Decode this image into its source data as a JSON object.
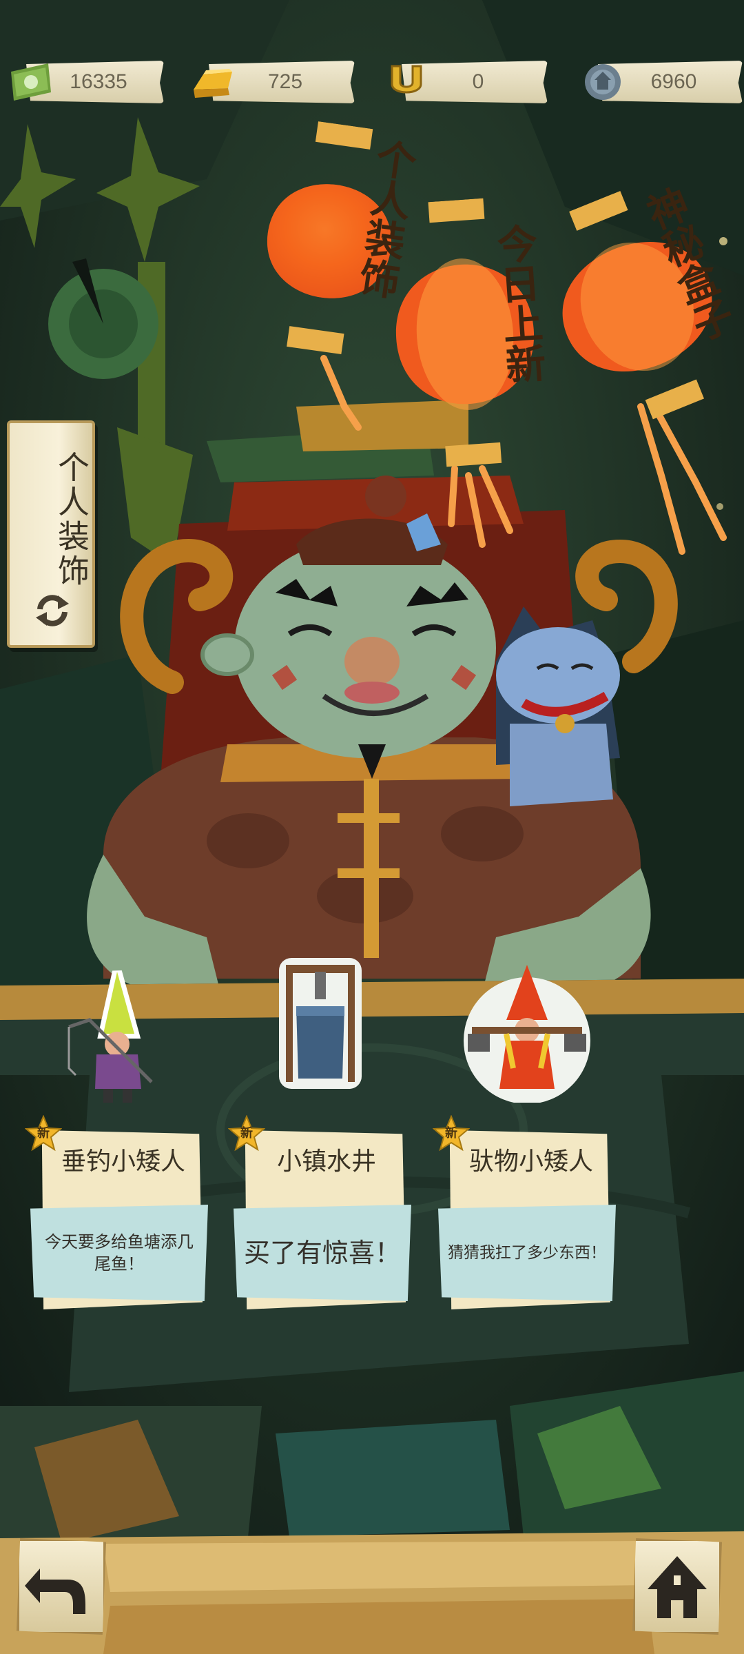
{
  "currency": [
    {
      "icon": "cash-icon",
      "value": "16335"
    },
    {
      "icon": "gold-bar-icon",
      "value": "725"
    },
    {
      "icon": "horseshoe-icon",
      "value": "0"
    },
    {
      "icon": "gear-token-icon",
      "value": "6960"
    }
  ],
  "lanterns": [
    {
      "label": "个人装饰"
    },
    {
      "label": "今日上新"
    },
    {
      "label": "神秘盒子"
    }
  ],
  "side_tab": {
    "label": "个人装饰",
    "icon": "refresh-icon"
  },
  "items": [
    {
      "badge": "新",
      "name": "垂钓小矮人",
      "desc": "今天要多给鱼塘添几尾鱼！"
    },
    {
      "badge": "新",
      "name": "小镇水井",
      "desc": "买了有惊喜！"
    },
    {
      "badge": "新",
      "name": "驮物小矮人",
      "desc": "猜猜我扛了多少东西！"
    }
  ],
  "bottom_bar": {
    "back_icon": "back-arrow-icon",
    "home_icon": "home-icon"
  },
  "colors": {
    "lantern": "#f25a1e",
    "paper": "#f3e8c4",
    "desc_box": "#bfe0df",
    "background": "#1c2a22"
  }
}
